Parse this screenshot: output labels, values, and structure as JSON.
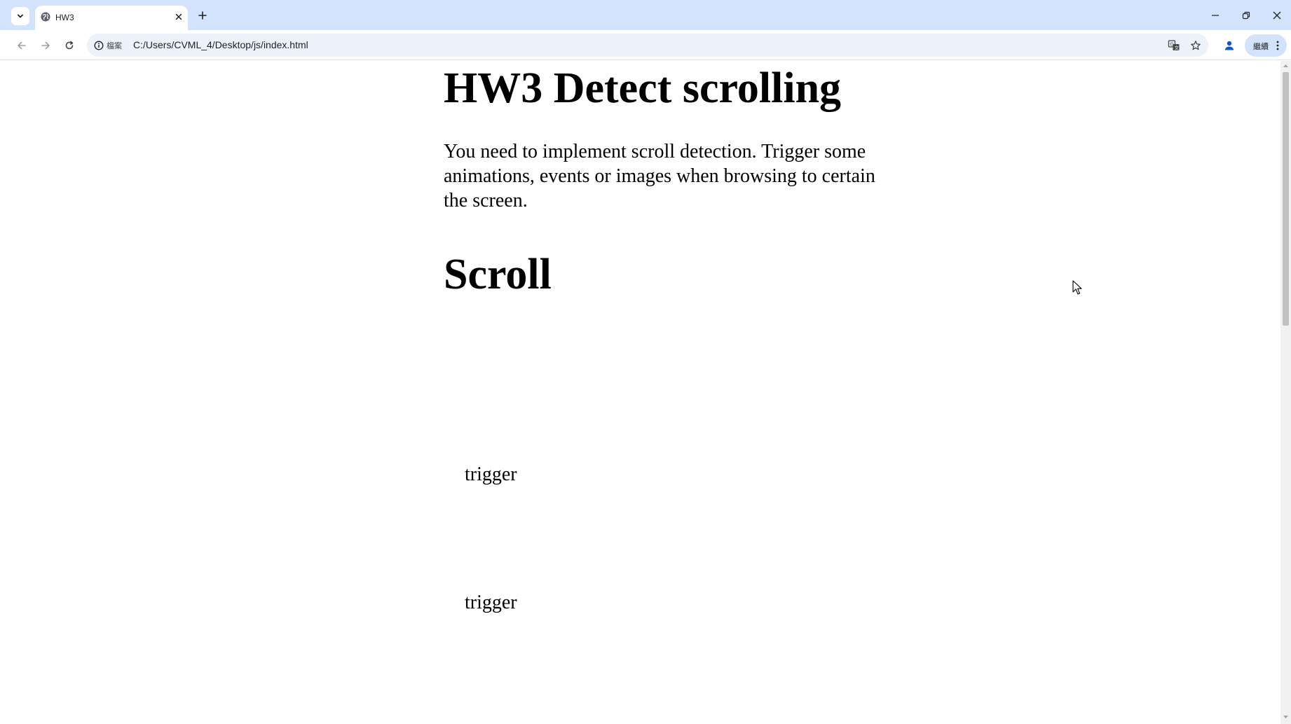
{
  "browser": {
    "tab_title": "HW3",
    "address_chip": "檔案",
    "url": "C:/Users/CVML_4/Desktop/js/index.html",
    "menu_label": "繼續"
  },
  "page": {
    "heading": "HW3 Detect scrolling",
    "paragraph": "You need to implement scroll detection. Trigger some animations, events or images when browsing to certain the screen.",
    "section_heading": "Scroll",
    "triggers": [
      "trigger",
      "trigger"
    ]
  },
  "colors": {
    "tabstrip_bg": "#d3e3fd",
    "omnibox_bg": "#edf2fa",
    "scroll_thumb": "#c1c1c1"
  },
  "icons": {
    "tab_search": "chevron-down-icon",
    "favicon": "globe-icon",
    "tab_close": "close-icon",
    "new_tab": "plus-icon",
    "back": "arrow-left-icon",
    "forward": "arrow-right-icon",
    "reload": "reload-icon",
    "site_info": "info-icon",
    "translate": "translate-icon",
    "bookmark": "star-icon",
    "profile": "person-icon",
    "menu": "more-vertical-icon"
  }
}
